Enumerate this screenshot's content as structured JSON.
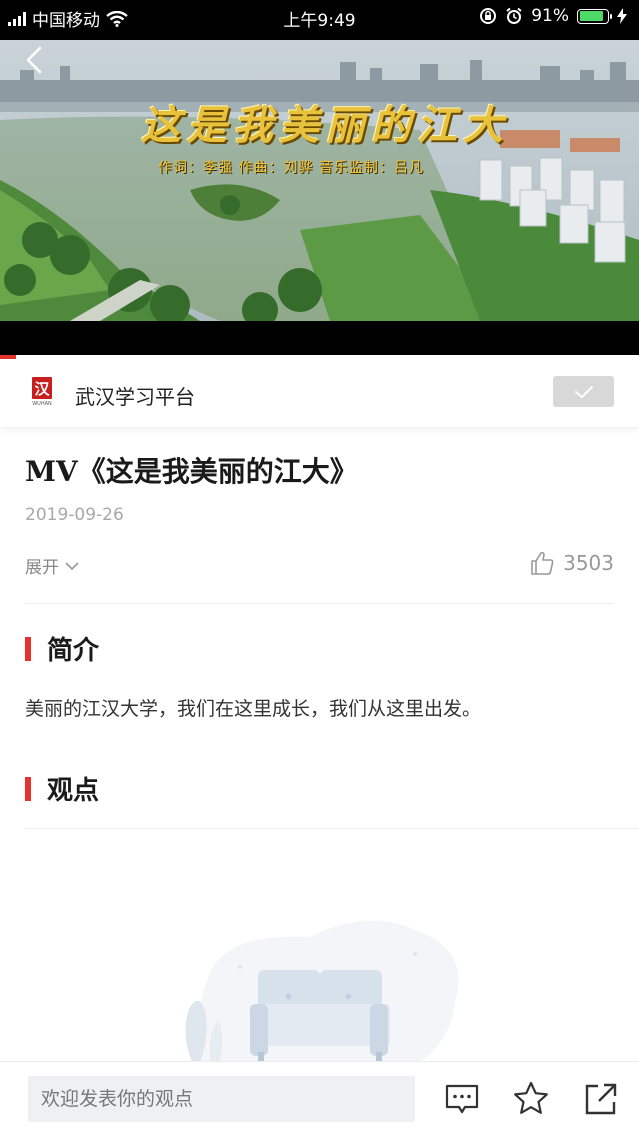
{
  "status_bar": {
    "carrier": "中国移动",
    "time": "上午9:49",
    "battery_percent": "91%",
    "battery_level": 0.91
  },
  "video": {
    "title_overlay": "这是我美丽的江大",
    "credits_overlay": "作词：李强 作曲：刘骅 音乐监制：吕凡",
    "progress": 0.025
  },
  "channel": {
    "logo_text": "汉",
    "logo_subtext": "WUHAN",
    "name": "武汉学习平台"
  },
  "article": {
    "title": "MV《这是我美丽的江大》",
    "date": "2019-09-26",
    "expand_label": "展开",
    "likes": "3503"
  },
  "sections": {
    "intro_heading": "简介",
    "intro_text": "美丽的江汉大学，我们在这里成长，我们从这里出发。",
    "opinions_heading": "观点"
  },
  "bottom_bar": {
    "comment_placeholder": "欢迎发表你的观点",
    "icons": [
      "comment-icon",
      "star-icon",
      "share-icon"
    ]
  },
  "colors": {
    "accent": "#e5322d",
    "follow_bg": "#d8d8d8",
    "video_title": "#e8c23a"
  }
}
